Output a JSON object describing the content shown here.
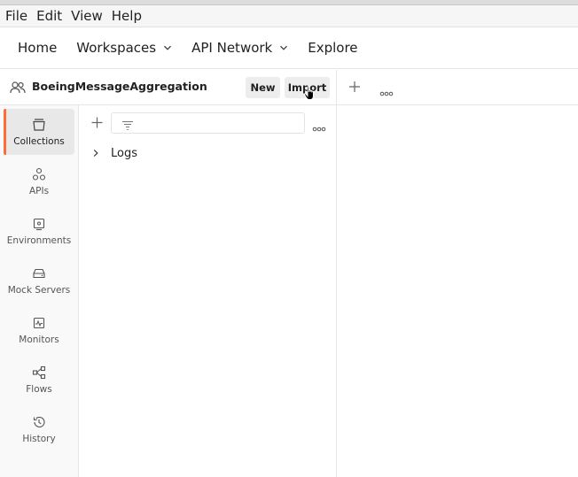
{
  "menubar": {
    "items": [
      "File",
      "Edit",
      "View",
      "Help"
    ]
  },
  "header": {
    "home": "Home",
    "workspaces": "Workspaces",
    "api_network": "API Network",
    "explore": "Explore"
  },
  "workspace": {
    "name": "BoeingMessageAggregation",
    "new_label": "New",
    "import_label": "Import"
  },
  "sidebar": {
    "items": [
      {
        "label": "Collections",
        "icon": "collections-icon",
        "active": true
      },
      {
        "label": "APIs",
        "icon": "apis-icon"
      },
      {
        "label": "Environments",
        "icon": "environments-icon"
      },
      {
        "label": "Mock Servers",
        "icon": "mock-servers-icon"
      },
      {
        "label": "Monitors",
        "icon": "monitors-icon"
      },
      {
        "label": "Flows",
        "icon": "flows-icon"
      },
      {
        "label": "History",
        "icon": "history-icon"
      }
    ]
  },
  "collections": {
    "items": [
      {
        "label": "Logs"
      }
    ]
  },
  "colors": {
    "accent": "#ff6c37"
  }
}
